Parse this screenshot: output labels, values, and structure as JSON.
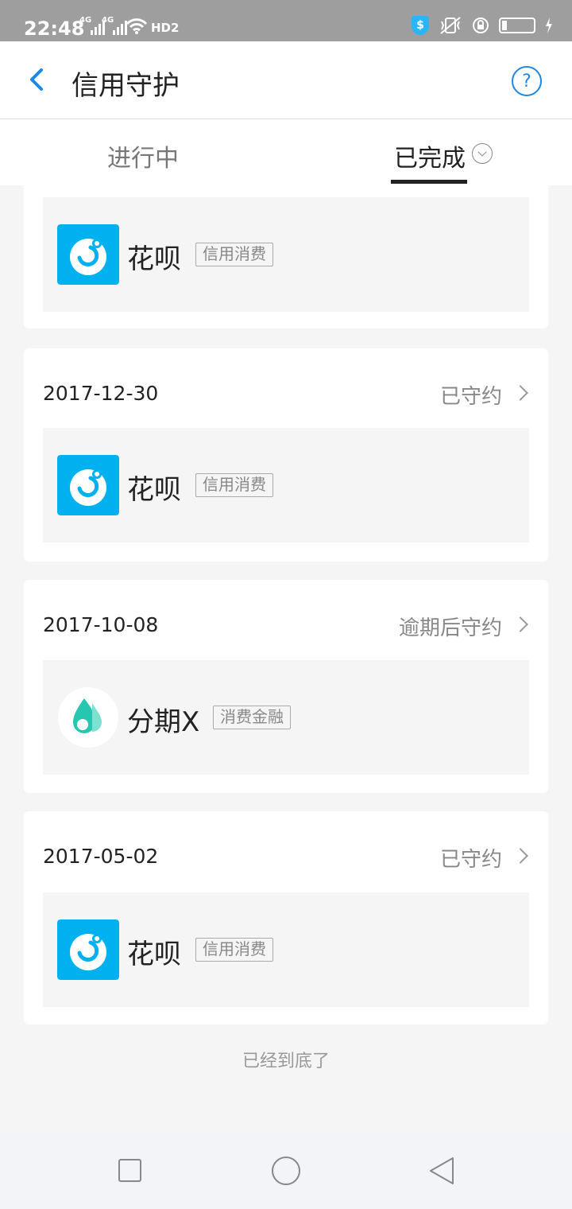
{
  "status_bar": {
    "time": "22:48",
    "signal1_label": "4G",
    "signal2_label": "4G",
    "hd_label": "HD2",
    "shield_label": "$"
  },
  "header": {
    "title": "信用守护",
    "help_label": "?"
  },
  "tabs": [
    {
      "label": "进行中",
      "active": false
    },
    {
      "label": "已完成",
      "active": true
    }
  ],
  "records": [
    {
      "date": "",
      "status": "",
      "product": "花呗",
      "tag": "信用消费",
      "logo": "huabei-icon"
    },
    {
      "date": "2017-12-30",
      "status": "已守约",
      "product": "花呗",
      "tag": "信用消费",
      "logo": "huabei-icon"
    },
    {
      "date": "2017-10-08",
      "status": "逾期后守约",
      "product": "分期X",
      "tag": "消费金融",
      "logo": "fenqix-icon"
    },
    {
      "date": "2017-05-02",
      "status": "已守约",
      "product": "花呗",
      "tag": "信用消费",
      "logo": "huabei-icon"
    }
  ],
  "footer": {
    "end_text": "已经到底了"
  },
  "colors": {
    "accent": "#1e88e5",
    "huabei_blue": "#00b0ef",
    "fenqix_teal": "#26c6b0"
  }
}
